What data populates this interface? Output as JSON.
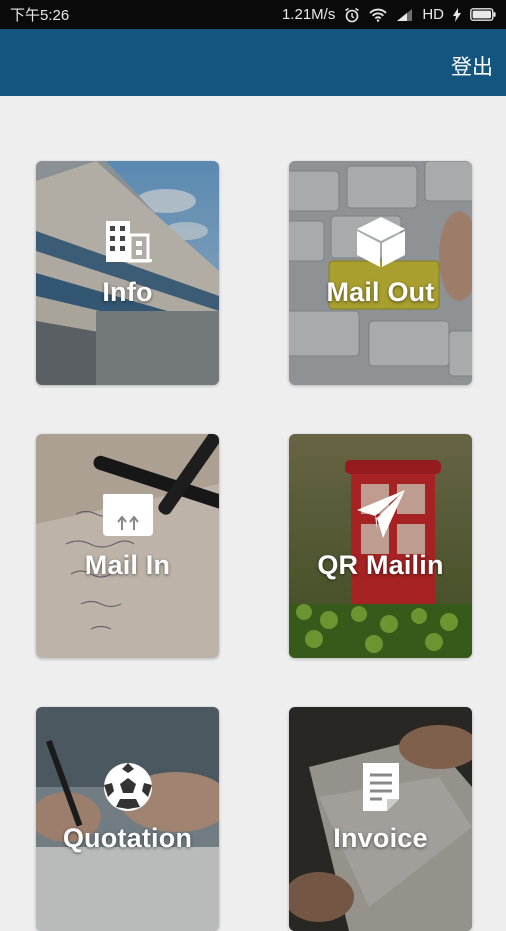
{
  "status_bar": {
    "time": "下午5:26",
    "speed": "1.21M/s",
    "network": "HD"
  },
  "header": {
    "logout_label": "登出",
    "bar_color": "#13557f"
  },
  "tiles": [
    {
      "label": "Info",
      "icon": "building-icon"
    },
    {
      "label": "Mail Out",
      "icon": "box-icon"
    },
    {
      "label": "Mail In",
      "icon": "package-icon"
    },
    {
      "label": "QR Mailin",
      "icon": "paper-plane-icon"
    },
    {
      "label": "Quotation",
      "icon": "soccer-ball-icon"
    },
    {
      "label": "Invoice",
      "icon": "document-icon"
    }
  ]
}
